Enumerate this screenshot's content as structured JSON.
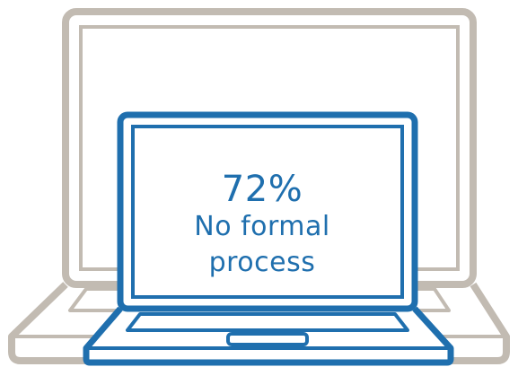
{
  "stat": {
    "value": "72%",
    "label": "No formal process"
  },
  "colors": {
    "foreground_laptop": "#1f6fae",
    "background_laptop": "#c2bbb2",
    "text": "#1f6fae"
  },
  "icons": {
    "background": "laptop-icon",
    "foreground": "laptop-icon"
  }
}
